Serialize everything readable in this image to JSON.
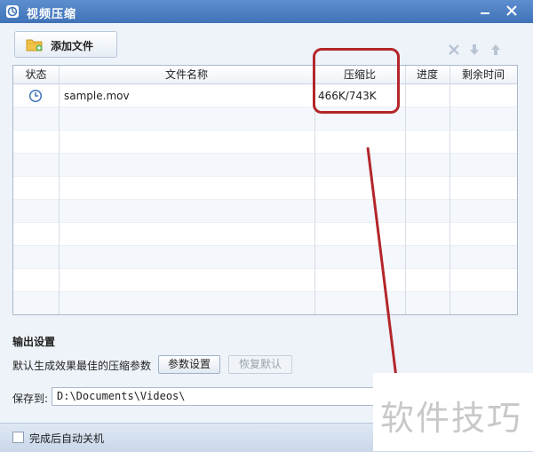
{
  "window": {
    "title": "视频压缩"
  },
  "toolbar": {
    "add_files_label": "添加文件"
  },
  "table": {
    "columns": [
      "状态",
      "文件名称",
      "压缩比",
      "进度",
      "剩余时间"
    ],
    "rows": [
      {
        "status_icon": "clock-icon",
        "filename": "sample.mov",
        "ratio": "466K/743K",
        "progress": "",
        "remaining": ""
      }
    ]
  },
  "output": {
    "section_title": "输出设置",
    "default_text": "默认生成效果最佳的压缩参数",
    "params_button": "参数设置",
    "restore_button": "恢复默认",
    "save_label": "保存到:",
    "save_path": "D:\\Documents\\Videos\\"
  },
  "statusbar": {
    "shutdown_label": "完成后自动关机"
  },
  "watermark": "软件技巧",
  "colors": {
    "titlebar": "#4a7fc1",
    "highlight": "#b3262a"
  }
}
